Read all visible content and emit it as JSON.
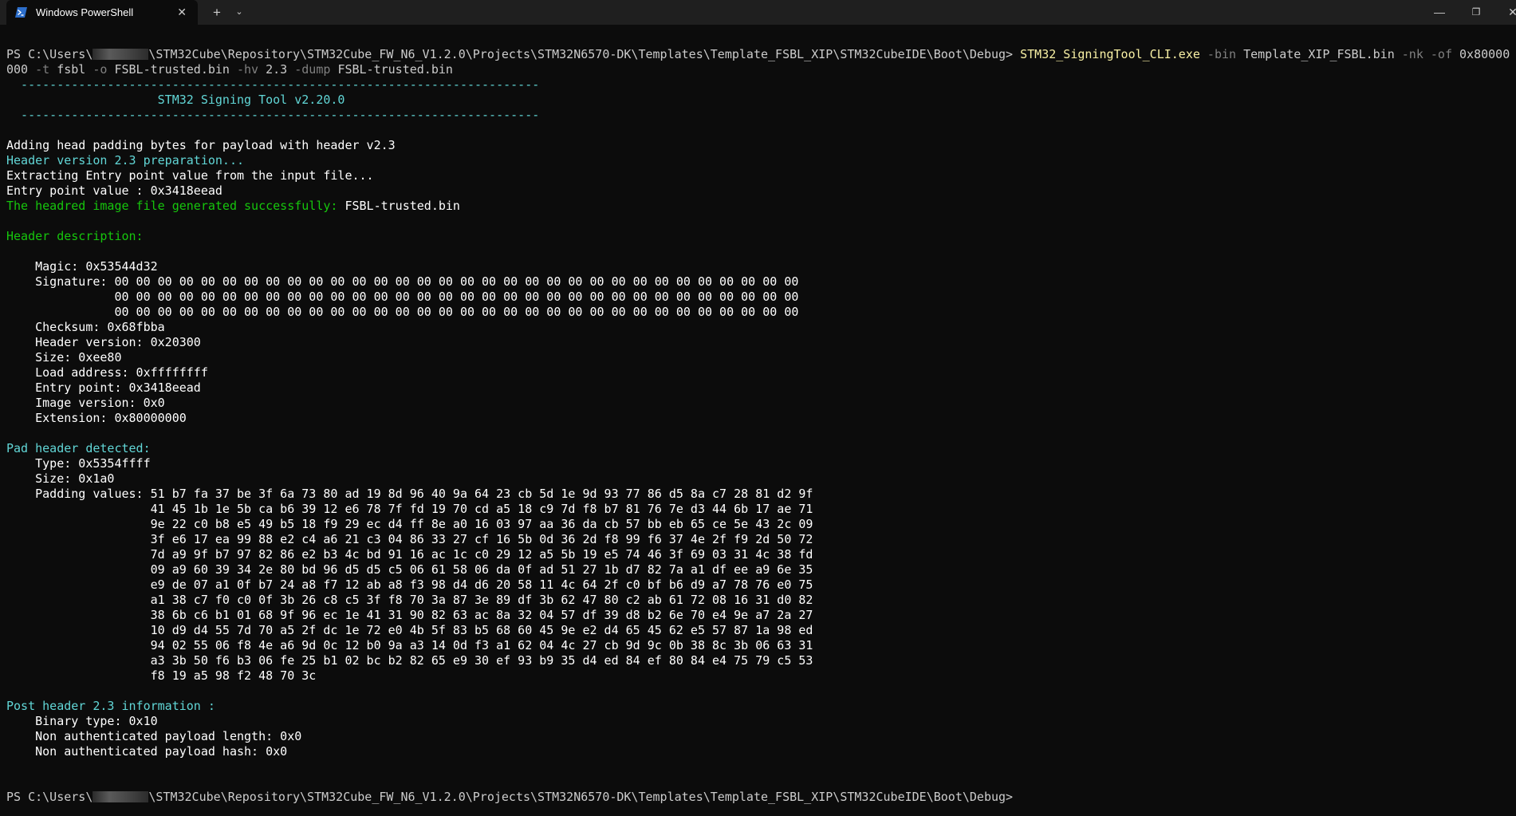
{
  "window": {
    "tab_title": "Windows PowerShell",
    "tab_close": "✕",
    "new_tab": "+",
    "dropdown": "⌄",
    "minimize": "—",
    "maximize": "❐",
    "close": "✕"
  },
  "icons": {
    "tab": "powershell-icon",
    "redaction": "redacted-username"
  },
  "colors": {
    "background": "#0c0c0c",
    "titlebar": "#1f1f1f",
    "text": "#cccccc",
    "command": "#f9f1a5",
    "parameter": "#808080",
    "cyan": "#61d6d6",
    "green": "#16c60c"
  },
  "terminal": {
    "prompt_start": "PS C:\\Users\\",
    "prompt_path": "\\STM32Cube\\Repository\\STM32Cube_FW_N6_V1.2.0\\Projects\\STM32N6570-DK\\Templates\\Template_FSBL_XIP\\STM32CubeIDE\\Boot\\Debug>",
    "cmd": {
      "exe": "STM32_SigningTool_CLI.exe",
      "p_bin": "-bin",
      "v_bin": "Template_XIP_FSBL.bin",
      "p_nk": "-nk",
      "p_of": "-of",
      "v_of_a": "0x80000",
      "v_of_b": "000",
      "p_t": "-t",
      "v_t": "fsbl",
      "p_o": "-o",
      "v_o": "FSBL-trusted.bin",
      "p_hv": "-hv",
      "v_hv": "2.3",
      "p_dump": "-dump",
      "v_dump": "FSBL-trusted.bin"
    },
    "banner_rule": "  ------------------------------------------------------------------------",
    "banner_title": "                     STM32 Signing Tool v2.20.0",
    "msg_padding": "Adding head padding bytes for payload with header v2.3",
    "msg_header_prep": "Header version 2.3 preparation...",
    "msg_extract": "Extracting Entry point value from the input file...",
    "msg_entry": "Entry point value : 0x3418eead",
    "msg_success_label": "The headred image file generated successfully: ",
    "msg_success_file": "FSBL-trusted.bin",
    "header_desc_title": "Header description:",
    "magic": "    Magic: 0x53544d32",
    "signature_1": "    Signature: 00 00 00 00 00 00 00 00 00 00 00 00 00 00 00 00 00 00 00 00 00 00 00 00 00 00 00 00 00 00 00 00",
    "signature_2": "               00 00 00 00 00 00 00 00 00 00 00 00 00 00 00 00 00 00 00 00 00 00 00 00 00 00 00 00 00 00 00 00",
    "signature_3": "               00 00 00 00 00 00 00 00 00 00 00 00 00 00 00 00 00 00 00 00 00 00 00 00 00 00 00 00 00 00 00 00",
    "checksum": "    Checksum: 0x68fbba",
    "header_version": "    Header version: 0x20300",
    "size": "    Size: 0xee80",
    "load_address": "    Load address: 0xffffffff",
    "entry_point": "    Entry point: 0x3418eead",
    "image_version": "    Image version: 0x0",
    "extension": "    Extension: 0x80000000",
    "pad_title": "Pad header detected:",
    "pad_type": "    Type: 0x5354ffff",
    "pad_size": "    Size: 0x1a0",
    "padding_lines": [
      "    Padding values: 51 b7 fa 37 be 3f 6a 73 80 ad 19 8d 96 40 9a 64 23 cb 5d 1e 9d 93 77 86 d5 8a c7 28 81 d2 9f",
      "                    41 45 1b 1e 5b ca b6 39 12 e6 78 7f fd 19 70 cd a5 18 c9 7d f8 b7 81 76 7e d3 44 6b 17 ae 71",
      "                    9e 22 c0 b8 e5 49 b5 18 f9 29 ec d4 ff 8e a0 16 03 97 aa 36 da cb 57 bb eb 65 ce 5e 43 2c 09",
      "                    3f e6 17 ea 99 88 e2 c4 a6 21 c3 04 86 33 27 cf 16 5b 0d 36 2d f8 99 f6 37 4e 2f f9 2d 50 72",
      "                    7d a9 9f b7 97 82 86 e2 b3 4c bd 91 16 ac 1c c0 29 12 a5 5b 19 e5 74 46 3f 69 03 31 4c 38 fd",
      "                    09 a9 60 39 34 2e 80 bd 96 d5 d5 c5 06 61 58 06 da 0f ad 51 27 1b d7 82 7a a1 df ee a9 6e 35",
      "                    e9 de 07 a1 0f b7 24 a8 f7 12 ab a8 f3 98 d4 d6 20 58 11 4c 64 2f c0 bf b6 d9 a7 78 76 e0 75",
      "                    a1 38 c7 f0 c0 0f 3b 26 c8 c5 3f f8 70 3a 87 3e 89 df 3b 62 47 80 c2 ab 61 72 08 16 31 d0 82",
      "                    38 6b c6 b1 01 68 9f 96 ec 1e 41 31 90 82 63 ac 8a 32 04 57 df 39 d8 b2 6e 70 e4 9e a7 2a 27",
      "                    10 d9 d4 55 7d 70 a5 2f dc 1e 72 e0 4b 5f 83 b5 68 60 45 9e e2 d4 65 45 62 e5 57 87 1a 98 ed",
      "                    94 02 55 06 f8 4e a6 9d 0c 12 b0 9a a3 14 0d f3 a1 62 04 4c 27 cb 9d 9c 0b 38 8c 3b 06 63 31",
      "                    a3 3b 50 f6 b3 06 fe 25 b1 02 bc b2 82 65 e9 30 ef 93 b9 35 d4 ed 84 ef 80 84 e4 75 79 c5 53",
      "                    f8 19 a5 98 f2 48 70 3c"
    ],
    "post_title": "Post header 2.3 information :",
    "binary_type": "    Binary type: 0x10",
    "non_auth_len": "    Non authenticated payload length: 0x0",
    "non_auth_hash": "    Non authenticated payload hash: 0x0"
  }
}
